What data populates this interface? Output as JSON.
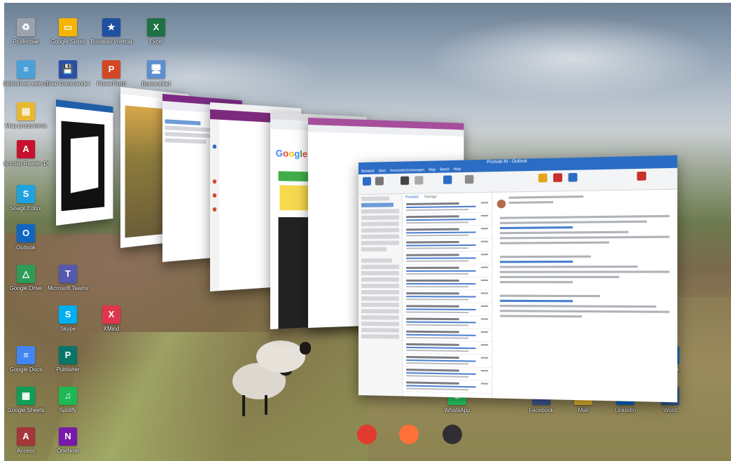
{
  "desktop": {
    "icons": [
      {
        "label": "Prullenbak",
        "icon": "recycle-bin-icon",
        "color": "#9aa3ad",
        "glyph": "♻"
      },
      {
        "label": "Google Slides",
        "icon": "google-slides-icon",
        "color": "#f4b400",
        "glyph": "▭"
      },
      {
        "label": "Bordeau Voetbal",
        "icon": "football-club-icon",
        "color": "#1f4fa0",
        "glyph": "★"
      },
      {
        "label": "Excel",
        "icon": "excel-icon",
        "color": "#1e7145",
        "glyph": "X"
      },
      {
        "label": "Bibliotheek selecteren",
        "icon": "library-icon",
        "color": "#4aa0d8",
        "glyph": "≡"
      },
      {
        "label": "Total Commander",
        "icon": "total-commander-icon",
        "color": "#2a4fa8",
        "glyph": "💾"
      },
      {
        "label": "PowerPoint",
        "icon": "powerpoint-icon",
        "color": "#d24726",
        "glyph": "P"
      },
      {
        "label": "Bureaublad",
        "icon": "desktop-shortcut-icon",
        "color": "#5d8ecf",
        "glyph": "🖥"
      },
      {
        "label": "Map programma",
        "icon": "folder-icon",
        "color": "#e8b930",
        "glyph": "▤"
      },
      {
        "label": "Acrobat Reader DC",
        "icon": "acrobat-icon",
        "color": "#c8102e",
        "glyph": "A"
      },
      {
        "label": "Snagit Editor",
        "icon": "snagit-icon",
        "color": "#1ea3e0",
        "glyph": "S"
      },
      {
        "label": "Outlook",
        "icon": "outlook-icon",
        "color": "#0f66c2",
        "glyph": "O"
      },
      {
        "label": "Google Drive",
        "icon": "google-drive-icon",
        "color": "#2d9c56",
        "glyph": "△"
      },
      {
        "label": "Microsoft Teams",
        "icon": "teams-icon",
        "color": "#5558af",
        "glyph": "T"
      },
      {
        "label": "Skype",
        "icon": "skype-icon",
        "color": "#00aff0",
        "glyph": "S"
      },
      {
        "label": "XMind",
        "icon": "xmind-icon",
        "color": "#e0364d",
        "glyph": "X"
      },
      {
        "label": "Google Docs",
        "icon": "google-docs-icon",
        "color": "#4285f4",
        "glyph": "≡"
      },
      {
        "label": "Publisher",
        "icon": "publisher-icon",
        "color": "#077568",
        "glyph": "P"
      },
      {
        "label": "Google Sheets",
        "icon": "google-sheets-icon",
        "color": "#0f9d58",
        "glyph": "▦"
      },
      {
        "label": "Spotify",
        "icon": "spotify-icon",
        "color": "#1db954",
        "glyph": "♫"
      },
      {
        "label": "OneNote",
        "icon": "onenote-icon",
        "color": "#7719aa",
        "glyph": "N"
      },
      {
        "label": "Access",
        "icon": "access-icon",
        "color": "#a4373a",
        "glyph": "A"
      },
      {
        "label": "Outlook",
        "icon": "outlook-right-icon",
        "color": "#0f66c2",
        "glyph": "O"
      },
      {
        "label": "Word",
        "icon": "word-icon",
        "color": "#2b579a",
        "glyph": "W"
      },
      {
        "label": "LinkedIn",
        "icon": "linkedin-icon",
        "color": "#0a66c2",
        "glyph": "in"
      },
      {
        "label": "Facebook",
        "icon": "facebook-icon",
        "color": "#3b5998",
        "glyph": "f"
      },
      {
        "label": "Mail",
        "icon": "mail-icon",
        "color": "#e8b930",
        "glyph": "✉"
      },
      {
        "label": "WhatsApp",
        "icon": "whatsapp-icon",
        "color": "#25d366",
        "glyph": "✆"
      }
    ],
    "bottom_icons": [
      {
        "label": "Snagit",
        "icon": "snagit-bottom-icon",
        "color": "#e23a2e"
      },
      {
        "label": "Firefox",
        "icon": "firefox-icon",
        "color": "#ff7139"
      },
      {
        "label": "OBS Studio",
        "icon": "obs-icon",
        "color": "#302e31"
      }
    ]
  },
  "task_view": {
    "google_window": {
      "search_query": "",
      "logo": "Google"
    },
    "outlook_window": {
      "title": "Postvak IN - Outlook",
      "tabs": [
        "Bestand",
        "Start",
        "Verzenden/ontvangen",
        "Map",
        "Beeld",
        "Help"
      ],
      "list_tabs": [
        "Prioriteit",
        "Overige"
      ]
    },
    "accent_colors": {
      "outlook": "#2b6cc4",
      "teams": "#5558af",
      "google_blue": "#4285f4"
    }
  }
}
